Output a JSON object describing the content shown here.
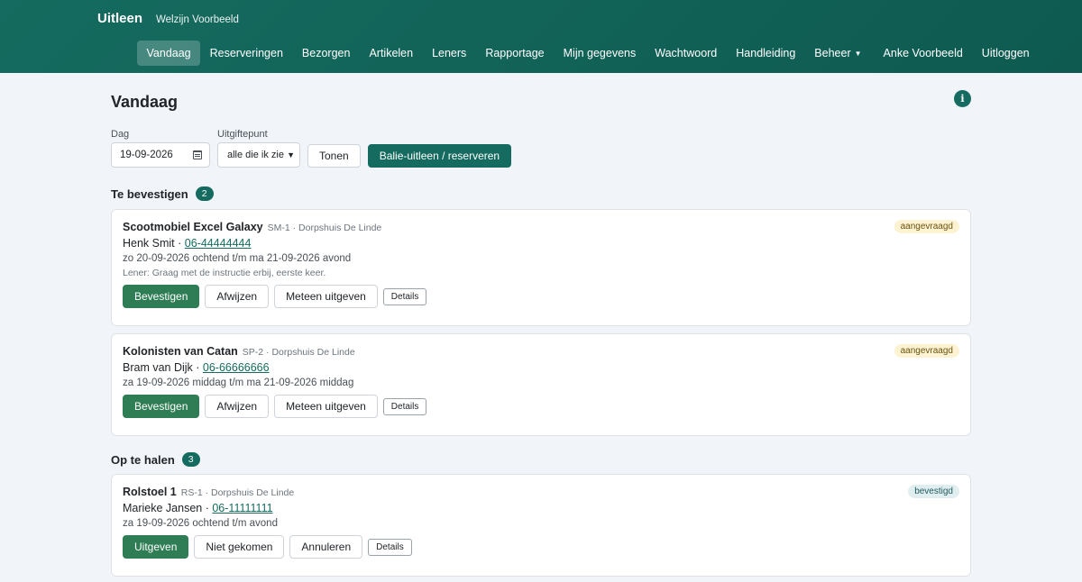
{
  "header": {
    "app": "Uitleen",
    "org": "Welzijn Voorbeeld"
  },
  "nav": {
    "items": [
      {
        "label": "Vandaag",
        "active": true
      },
      {
        "label": "Reserveringen"
      },
      {
        "label": "Bezorgen"
      },
      {
        "label": "Artikelen"
      },
      {
        "label": "Leners"
      },
      {
        "label": "Rapportage"
      },
      {
        "label": "Mijn gegevens"
      },
      {
        "label": "Wachtwoord"
      },
      {
        "label": "Handleiding"
      },
      {
        "label": "Beheer"
      }
    ],
    "user": "Anke Voorbeeld",
    "logout": "Uitloggen"
  },
  "page": {
    "title": "Vandaag"
  },
  "filters": {
    "day_label": "Dag",
    "day_value": "19-09-2026",
    "point_label": "Uitgiftepunt",
    "point_value": "alle die ik zie",
    "show_button": "Tonen",
    "counter_button": "Balie-uitleen / reserveren"
  },
  "sections": {
    "confirm": {
      "title": "Te bevestigen",
      "count": "2",
      "cards": [
        {
          "item": "Scootmobiel Excel Galaxy",
          "meta": "SM-1 · Dorpshuis De Linde",
          "status": "aangevraagd",
          "person": "Henk Smit",
          "phone": "06-44444444",
          "period": "zo 20-09-2026 ochtend t/m ma 21-09-2026 avond",
          "note": "Lener: Graag met de instructie erbij, eerste keer.",
          "actions": {
            "primary": "Bevestigen",
            "reject": "Afwijzen",
            "issue": "Meteen uitgeven",
            "details": "Details"
          }
        },
        {
          "item": "Kolonisten van Catan",
          "meta": "SP-2 · Dorpshuis De Linde",
          "status": "aangevraagd",
          "person": "Bram van Dijk",
          "phone": "06-66666666",
          "period": "za 19-09-2026 middag t/m ma 21-09-2026 middag",
          "actions": {
            "primary": "Bevestigen",
            "reject": "Afwijzen",
            "issue": "Meteen uitgeven",
            "details": "Details"
          }
        }
      ]
    },
    "pickup": {
      "title": "Op te halen",
      "count": "3",
      "cards": [
        {
          "item": "Rolstoel 1",
          "meta": "RS-1 · Dorpshuis De Linde",
          "status": "bevestigd",
          "person": "Marieke Jansen",
          "phone": "06-11111111",
          "period": "za 19-09-2026 ochtend t/m avond",
          "actions": {
            "primary": "Uitgeven",
            "noshow": "Niet gekomen",
            "cancel": "Annuleren",
            "details": "Details"
          }
        }
      ]
    }
  },
  "colors": {
    "brand": "#156b5f",
    "success": "#2f7d55",
    "background": "#f1f5f9"
  },
  "icons": {
    "info": "info-icon",
    "calendar": "calendar-icon",
    "dropdown": "chevron-down-icon"
  }
}
